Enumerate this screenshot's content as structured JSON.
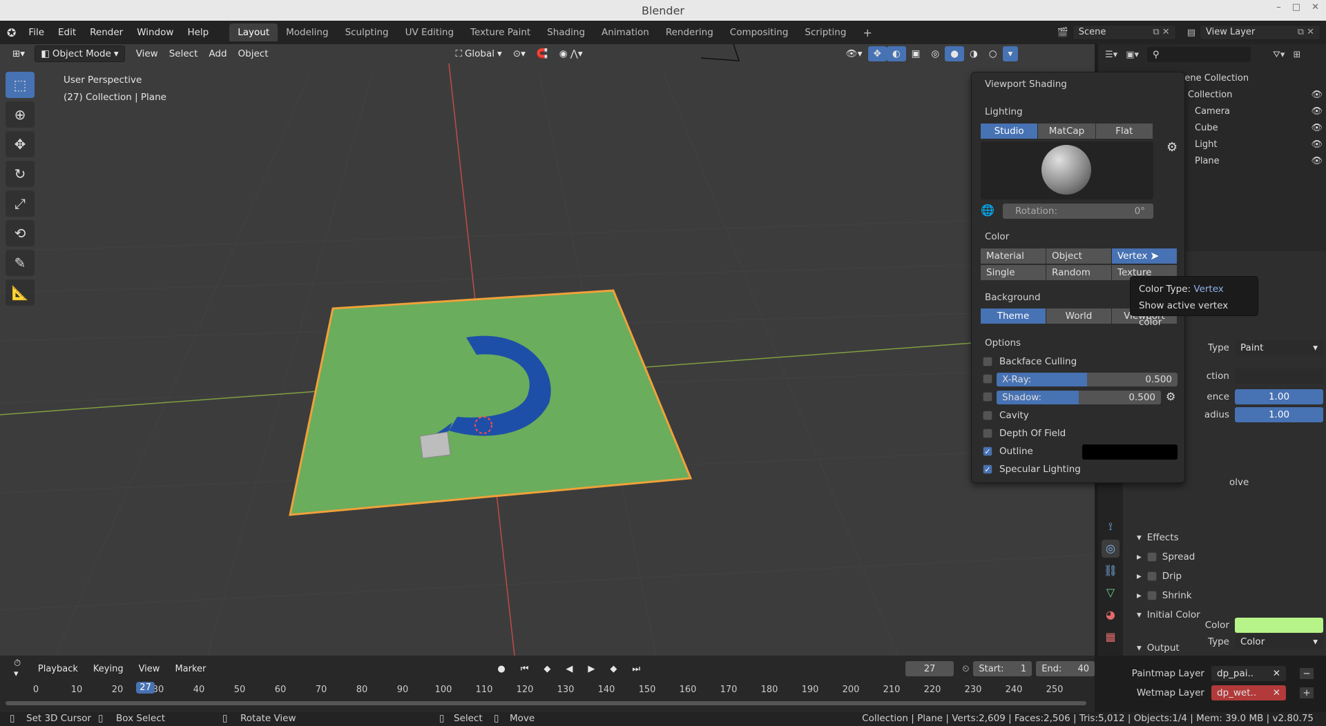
{
  "window": {
    "title": "Blender",
    "controls": [
      "–",
      "□",
      "✕"
    ]
  },
  "menubar": {
    "items": [
      "File",
      "Edit",
      "Render",
      "Window",
      "Help"
    ]
  },
  "workspaces": {
    "tabs": [
      "Layout",
      "Modeling",
      "Sculpting",
      "UV Editing",
      "Texture Paint",
      "Shading",
      "Animation",
      "Rendering",
      "Compositing",
      "Scripting"
    ],
    "active": "Layout",
    "add": "+"
  },
  "scene": {
    "name": "Scene",
    "view_layer": "View Layer"
  },
  "viewport_header": {
    "mode": "Object Mode",
    "menus": [
      "View",
      "Select",
      "Add",
      "Object"
    ],
    "orientation": "Global"
  },
  "viewport_info": {
    "perspective": "User Perspective",
    "collection": "(27) Collection | Plane"
  },
  "shading_popover": {
    "title": "Viewport Shading",
    "lighting_label": "Lighting",
    "lighting_options": [
      "Studio",
      "MatCap",
      "Flat"
    ],
    "lighting_active": "Studio",
    "rotation_label": "Rotation:",
    "rotation_value": "0°",
    "color_label": "Color",
    "color_options_row1": [
      "Material",
      "Object",
      "Vertex"
    ],
    "color_options_row2": [
      "Single",
      "Random",
      "Texture"
    ],
    "color_active": "Vertex",
    "background_label": "Background",
    "background_options": [
      "Theme",
      "World",
      "Viewport"
    ],
    "background_active": "Theme",
    "options_label": "Options",
    "backface": "Backface Culling",
    "xray_label": "X-Ray:",
    "xray_value": "0.500",
    "xray_fraction": 0.5,
    "shadow_label": "Shadow:",
    "shadow_value": "0.500",
    "shadow_fraction": 0.5,
    "cavity": "Cavity",
    "dof": "Depth Of Field",
    "outline": "Outline",
    "specular": "Specular Lighting"
  },
  "tooltip": {
    "key": "Color Type:",
    "value": "Vertex",
    "description": "Show active vertex color"
  },
  "outliner": {
    "header": "Scene Collection",
    "rows": [
      "Collection",
      "Camera",
      "Cube",
      "Light",
      "Plane"
    ]
  },
  "properties": {
    "surface_type_label": "Type",
    "surface_type_value": "Paint",
    "collection_label": "ction",
    "influence_label": "ence",
    "influence_value": "1.00",
    "radius_label": "adius",
    "radius_value": "1.00",
    "dissolve": "olve",
    "effects": "Effects",
    "spread": "Spread",
    "drip": "Drip",
    "shrink": "Shrink",
    "initial_color": "Initial Color",
    "ic_type_label": "Type",
    "ic_type_value": "Color",
    "ic_color_label": "Color",
    "ic_color_hex": "#b6f48a",
    "output": "Output",
    "paintmap_label": "Paintmap Layer",
    "paintmap_value": "dp_pai..",
    "wetmap_label": "Wetmap Layer",
    "wetmap_value": "dp_wet.."
  },
  "timeline": {
    "menus": [
      "Playback",
      "Keying",
      "View",
      "Marker"
    ],
    "current_frame": "27",
    "start_label": "Start:",
    "start": "1",
    "end_label": "End:",
    "end": "40",
    "ticks": [
      "0",
      "10",
      "20",
      "30",
      "40",
      "50",
      "60",
      "70",
      "80",
      "90",
      "100",
      "110",
      "120",
      "130",
      "140",
      "150",
      "160",
      "170",
      "180",
      "190",
      "200",
      "210",
      "220",
      "230",
      "240",
      "250"
    ]
  },
  "statusbar": {
    "items": [
      "Set 3D Cursor",
      "Box Select",
      "Rotate View",
      "Select",
      "Move"
    ],
    "stats": "Collection | Plane | Verts:2,609 | Faces:2,506 | Tris:5,012 | Objects:1/4 | Mem: 39.0 MB | v2.80.75"
  },
  "colors": {
    "accent": "#4772b3",
    "plane": "#6aad5c",
    "selection": "#f0a13a",
    "paint": "#1e4fa8"
  }
}
